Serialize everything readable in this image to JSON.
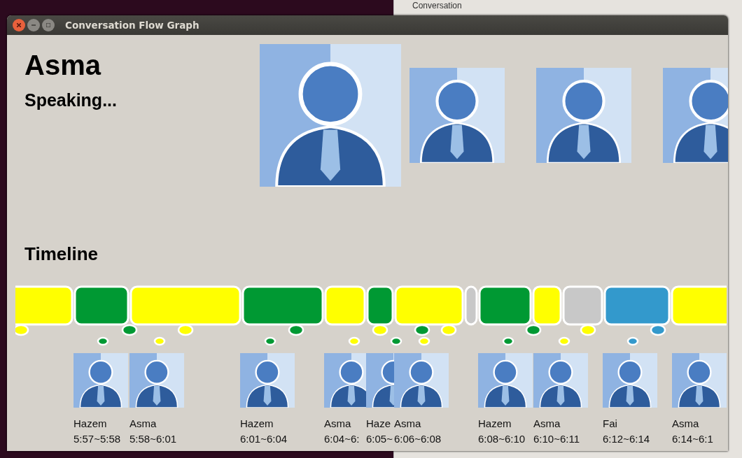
{
  "background_window": {
    "group_label": "Conversation"
  },
  "window": {
    "title": "Conversation Flow Graph"
  },
  "current_speaker": {
    "name": "Asma",
    "status": "Speaking..."
  },
  "participants": [
    {
      "active": true
    },
    {
      "active": false
    },
    {
      "active": false
    },
    {
      "active": false
    }
  ],
  "timeline": {
    "heading": "Timeline",
    "segments": [
      {
        "color": "#ffff00"
      },
      {
        "color": "#009933"
      },
      {
        "color": "#ffff00"
      },
      {
        "color": "#009933"
      },
      {
        "color": "#ffff00"
      },
      {
        "color": "#009933"
      },
      {
        "color": "#ffff00"
      },
      {
        "color": "#c8c8c8"
      },
      {
        "color": "#009933"
      },
      {
        "color": "#ffff00"
      },
      {
        "color": "#c8c8c8"
      },
      {
        "color": "#3399cc"
      },
      {
        "color": "#ffff00"
      }
    ],
    "clips": [
      {
        "name": "Hazem",
        "time": "5:57~5:58"
      },
      {
        "name": "Asma",
        "time": "5:58~6:01"
      },
      {
        "name": "Hazem",
        "time": "6:01~6:04"
      },
      {
        "name": "Asma",
        "time": "6:04~6:"
      },
      {
        "name": "Haze",
        "time": "6:05~"
      },
      {
        "name": "Asma",
        "time": "6:06~6:08"
      },
      {
        "name": "Hazem",
        "time": "6:08~6:10"
      },
      {
        "name": "Asma",
        "time": "6:10~6:11"
      },
      {
        "name": "Fai",
        "time": "6:12~6:14"
      },
      {
        "name": "Asma",
        "time": "6:14~6:1"
      }
    ]
  }
}
